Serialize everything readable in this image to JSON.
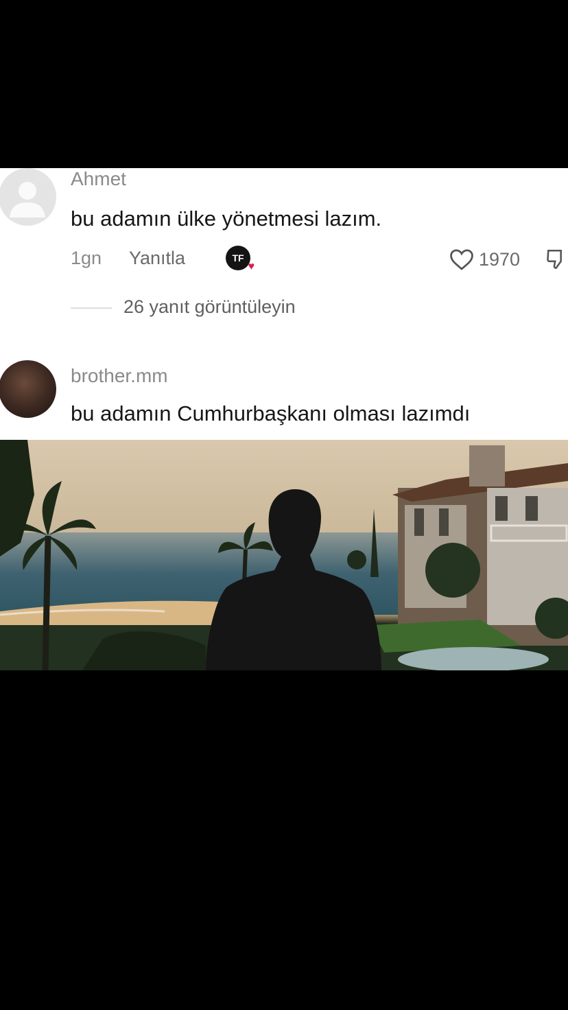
{
  "comments": [
    {
      "username": "Ahmet",
      "text": "bu adamın ülke yönetmesi lazım.",
      "time": "1gn",
      "reply_label": "Yanıtla",
      "badge": "TF",
      "likes": "1970",
      "view_replies": "26 yanıt görüntüleyin"
    },
    {
      "username": "brother.mm",
      "text": "bu adamın Cumhurbaşkanı olması lazımdı"
    }
  ]
}
